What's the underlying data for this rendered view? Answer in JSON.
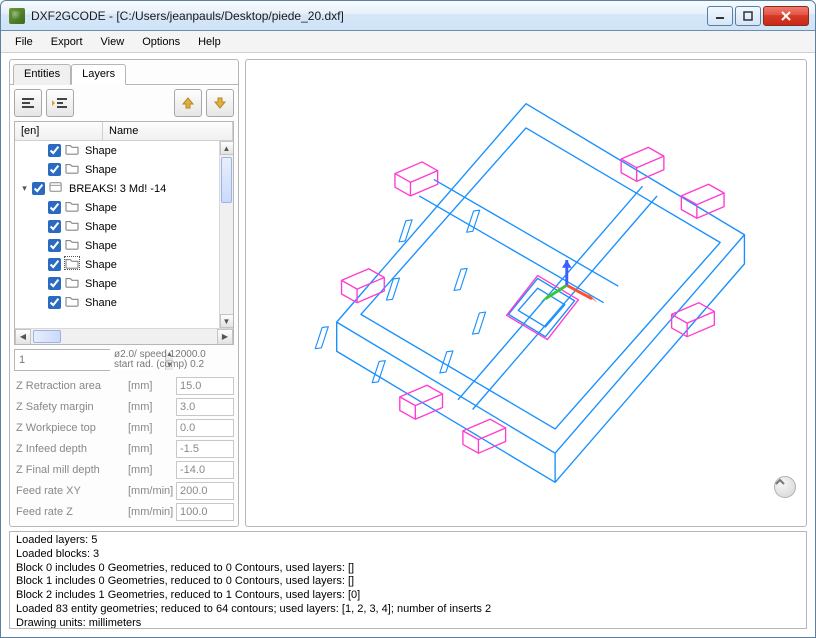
{
  "window": {
    "title": "DXF2GCODE - [C:/Users/jeanpauls/Desktop/piede_20.dxf]"
  },
  "menu": {
    "file": "File",
    "export": "Export",
    "view": "View",
    "options": "Options",
    "help": "Help"
  },
  "tabs": {
    "entities": "Entities",
    "layers": "Layers"
  },
  "tree": {
    "header_col1": "[en]",
    "header_col2": "Name",
    "rows": [
      {
        "indent": 1,
        "checked": true,
        "label": "Shape"
      },
      {
        "indent": 1,
        "checked": true,
        "label": "Shape"
      },
      {
        "indent": 0,
        "checked": true,
        "label": "BREAKS! 3 Md! -14",
        "expander": "▾",
        "nofolder": true
      },
      {
        "indent": 1,
        "checked": true,
        "label": "Shape"
      },
      {
        "indent": 1,
        "checked": true,
        "label": "Shape"
      },
      {
        "indent": 1,
        "checked": true,
        "label": "Shape"
      },
      {
        "indent": 1,
        "checked": true,
        "label": "Shape",
        "selected": true
      },
      {
        "indent": 1,
        "checked": true,
        "label": "Shape"
      },
      {
        "indent": 1,
        "checked": true,
        "label": "Shane"
      }
    ]
  },
  "spinner": {
    "value": "1",
    "info_line1": "ø2.0/ speed 12000.0",
    "info_line2": "start rad. (comp) 0.2"
  },
  "params": {
    "rows": [
      {
        "label": "Z Retraction area",
        "unit": "[mm]",
        "value": "15.0"
      },
      {
        "label": "Z Safety margin",
        "unit": "[mm]",
        "value": "3.0"
      },
      {
        "label": "Z Workpiece top",
        "unit": "[mm]",
        "value": "0.0"
      },
      {
        "label": "Z Infeed depth",
        "unit": "[mm]",
        "value": "-1.5"
      },
      {
        "label": "Z Final mill depth",
        "unit": "[mm]",
        "value": "-14.0"
      },
      {
        "label": "Feed rate XY",
        "unit": "[mm/min]",
        "value": "200.0"
      },
      {
        "label": "Feed rate Z",
        "unit": "[mm/min]",
        "value": "100.0"
      }
    ]
  },
  "log": {
    "lines": [
      "Loaded layers: 5",
      "Loaded blocks: 3",
      "Block 0 includes 0 Geometries, reduced to 0 Contours, used layers: []",
      "Block 1 includes 0 Geometries, reduced to 0 Contours, used layers: []",
      "Block 2 includes 1 Geometries, reduced to 1 Contours, used layers: [0]",
      "Loaded 83 entity geometries; reduced to 64 contours; used layers: [1, 2, 3, 4]; number of inserts 2",
      "Drawing units: millimeters"
    ]
  },
  "colors": {
    "outline_blue": "#1790ff",
    "magenta": "#ff3cd0",
    "axis_red": "#ff4d2e",
    "axis_green": "#37c637",
    "axis_blue": "#3a5eff"
  }
}
